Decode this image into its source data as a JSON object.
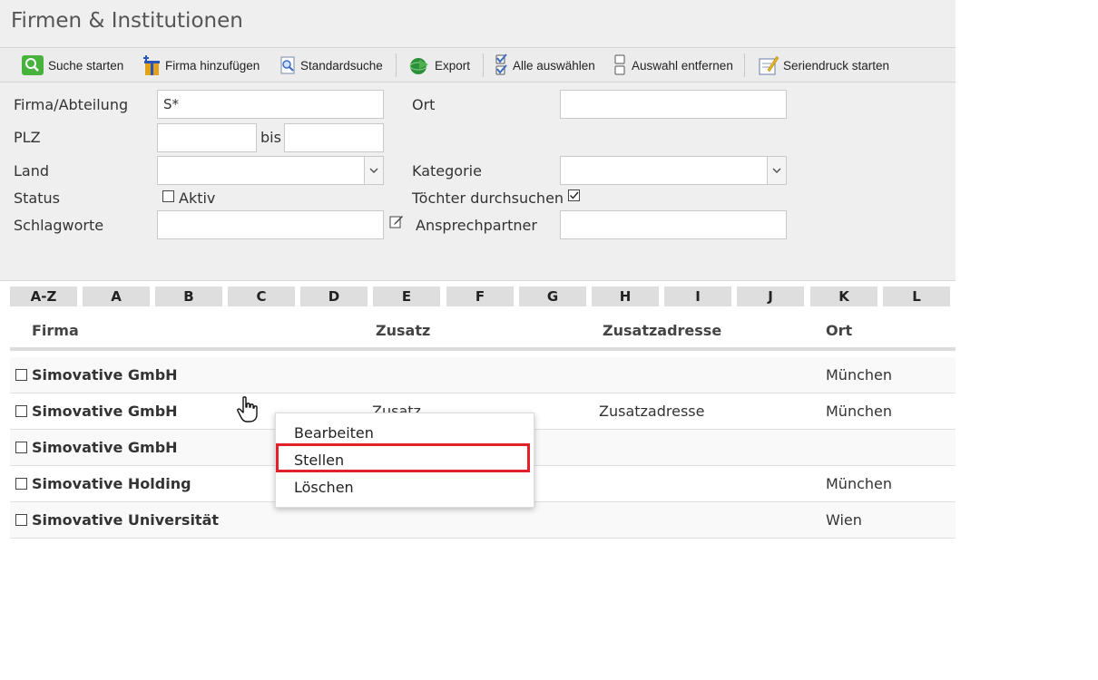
{
  "title": "Firmen & Institutionen",
  "toolbar": {
    "search": "Suche starten",
    "add_company": "Firma hinzufügen",
    "standard_search": "Standardsuche",
    "export": "Export",
    "select_all": "Alle auswählen",
    "deselect": "Auswahl entfernen",
    "mail_merge": "Seriendruck starten"
  },
  "form": {
    "firma_label": "Firma/Abteilung",
    "firma_value": "S*",
    "ort_label": "Ort",
    "ort_value": "",
    "plz_label": "PLZ",
    "plz_from": "",
    "plz_bis": "bis",
    "plz_to": "",
    "land_label": "Land",
    "land_value": "",
    "kategorie_label": "Kategorie",
    "kategorie_value": "",
    "status_label": "Status",
    "aktiv_label": "Aktiv",
    "aktiv_checked": false,
    "toechter_label": "Töchter durchsuchen",
    "toechter_checked": true,
    "schlagworte_label": "Schlagworte",
    "schlagworte_value": "",
    "ansprech_label": "Ansprechpartner",
    "ansprech_value": ""
  },
  "letters": [
    "A-Z",
    "A",
    "B",
    "C",
    "D",
    "E",
    "F",
    "G",
    "H",
    "I",
    "J",
    "K",
    "L"
  ],
  "table": {
    "headers": {
      "firma": "Firma",
      "zusatz": "Zusatz",
      "zusatzadresse": "Zusatzadresse",
      "ort": "Ort"
    },
    "rows": [
      {
        "firma": "Simovative GmbH",
        "zusatz": "",
        "zusatzadresse": "",
        "ort": "München"
      },
      {
        "firma": "Simovative GmbH",
        "zusatz": "Zusatz",
        "zusatzadresse": "Zusatzadresse",
        "ort": "München"
      },
      {
        "firma": "Simovative GmbH",
        "zusatz": "",
        "zusatzadresse": "",
        "ort": ""
      },
      {
        "firma": "Simovative Holding",
        "zusatz": "",
        "zusatzadresse": "",
        "ort": "München"
      },
      {
        "firma": "Simovative Universität",
        "zusatz": "",
        "zusatzadresse": "",
        "ort": "Wien"
      }
    ]
  },
  "context_menu": {
    "items": [
      "Bearbeiten",
      "Stellen",
      "Löschen"
    ],
    "highlighted": "Stellen"
  },
  "colors": {
    "highlight": "#e3212b",
    "panel": "#efefef"
  }
}
